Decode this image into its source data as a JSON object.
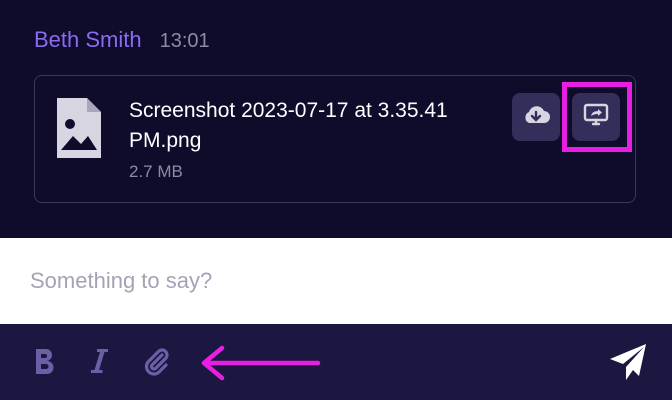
{
  "message": {
    "author": "Beth Smith",
    "time": "13:01",
    "attachment": {
      "file_name": "Screenshot 2023-07-17 at 3.35.41 PM.png",
      "file_size": "2.7 MB",
      "icon": "image-file-icon",
      "actions": [
        {
          "name": "download",
          "icon": "cloud-download-icon"
        },
        {
          "name": "share-screen",
          "icon": "monitor-share-icon"
        }
      ]
    }
  },
  "composer": {
    "placeholder": "Something to say?",
    "value": ""
  },
  "toolbar": {
    "tools": [
      {
        "name": "bold",
        "icon": "bold-icon",
        "glyph": "B"
      },
      {
        "name": "italic",
        "icon": "italic-icon",
        "glyph": "I"
      },
      {
        "name": "attach",
        "icon": "paperclip-icon"
      }
    ],
    "send_icon": "send-icon"
  },
  "colors": {
    "chat_bg": "#0e0b2b",
    "toolbar_bg": "#1b1740",
    "author": "#8c6bf0",
    "muted": "#8e8aa3",
    "button_bg": "#342f5a",
    "annotation": "#e81fe2",
    "icon": "#6b5fa8"
  }
}
